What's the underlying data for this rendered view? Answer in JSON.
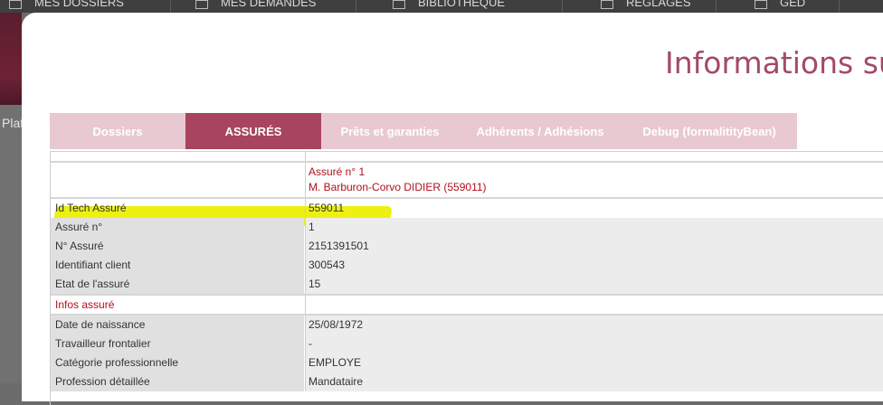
{
  "topnav": {
    "items": [
      {
        "label": "MES DOSSIERS",
        "icon": "folder-icon"
      },
      {
        "label": "MES DEMANDES",
        "icon": "clipboard-icon"
      },
      {
        "label": "BIBLIOTHÈQUE",
        "icon": "star-icon"
      },
      {
        "label": "RÉGLAGES",
        "icon": "settings-icon"
      },
      {
        "label": "GED",
        "icon": "document-icon"
      }
    ]
  },
  "background": {
    "plat_text": "Plat"
  },
  "modal": {
    "title": "Informations sur",
    "tabs": [
      {
        "label": "Dossiers",
        "active": false
      },
      {
        "label": "ASSURÉS",
        "active": true
      },
      {
        "label": "Prêts et garanties",
        "active": false
      },
      {
        "label": "Adhérents / Adhésions",
        "active": false
      },
      {
        "label": "Debug (formalitityBean)",
        "active": false
      }
    ],
    "assure_header": {
      "line1": "Assuré n° 1",
      "line2": "M. Barburon-Corvo DIDIER (559011)"
    },
    "fields": [
      {
        "label": "Id Tech Assuré",
        "value": "559011",
        "highlighted": true
      },
      {
        "label": "Assuré n°",
        "value": "1"
      },
      {
        "label": "N° Assuré",
        "value": "2151391501"
      },
      {
        "label": "Identifiant client",
        "value": "300543"
      },
      {
        "label": "Etat de l'assuré",
        "value": "15"
      }
    ],
    "infos_section": "Infos assuré",
    "infos_fields": [
      {
        "label": "Date de naissance",
        "value": "25/08/1972"
      },
      {
        "label": "Travailleur frontalier",
        "value": "-"
      },
      {
        "label": "Catégorie professionnelle",
        "value": "EMPLOYE"
      },
      {
        "label": "Profession détaillée",
        "value": "Mandataire"
      }
    ]
  },
  "colors": {
    "accent": "#a8445f",
    "tab_bar": "#e8c9d1",
    "title": "#a34a66",
    "section_red": "#b00f1c",
    "highlighter": "#eef014"
  }
}
